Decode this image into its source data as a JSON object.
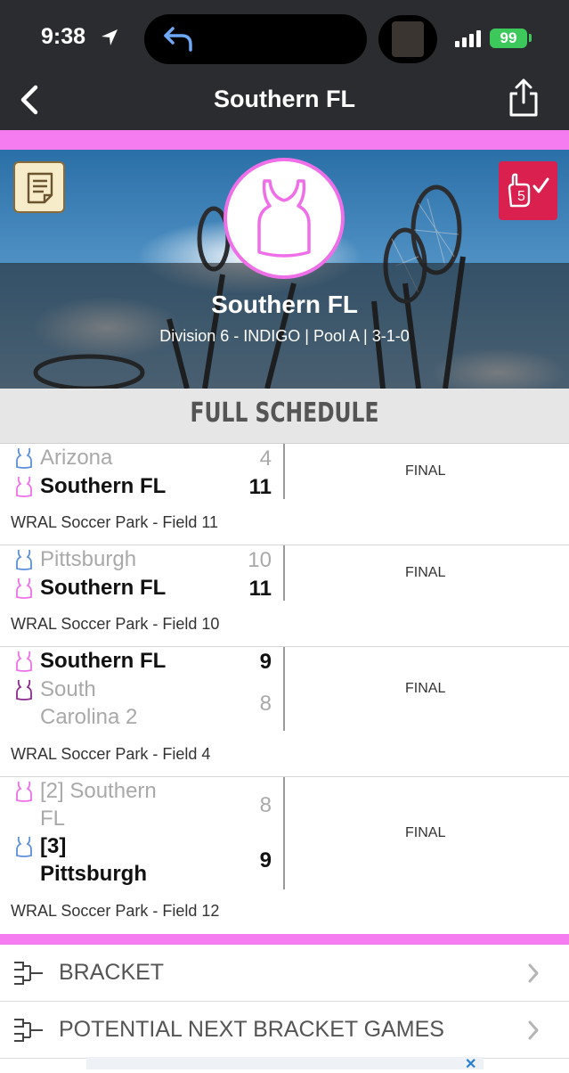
{
  "status_bar": {
    "time": "9:38",
    "battery": "99"
  },
  "nav": {
    "title": "Southern FL",
    "back_icon": "chevron-left-icon",
    "share_icon": "share-icon"
  },
  "team": {
    "name": "Southern FL",
    "subtitle": "Division 6 - INDIGO | Pool A | 3-1-0",
    "color": "#f57cf0"
  },
  "schedule": {
    "title": "FULL SCHEDULE",
    "games": [
      {
        "home": "Arizona",
        "home_score": "4",
        "home_result": "lose",
        "home_color": "#5b8fd8",
        "away": "Southern FL",
        "away_score": "11",
        "away_result": "win",
        "away_color": "#ef6fe8",
        "status": "FINAL",
        "venue": "WRAL Soccer Park - Field 11"
      },
      {
        "home": "Pittsburgh",
        "home_score": "10",
        "home_result": "lose",
        "home_color": "#5b8fd8",
        "away": "Southern FL",
        "away_score": "11",
        "away_result": "win",
        "away_color": "#ef6fe8",
        "status": "FINAL",
        "venue": "WRAL Soccer Park - Field 10"
      },
      {
        "home": "Southern FL",
        "home_score": "9",
        "home_result": "win",
        "home_color": "#ef6fe8",
        "away_line1": "South",
        "away_line2": "Carolina 2",
        "away_score": "8",
        "away_result": "lose",
        "away_color": "#8b2a8f",
        "status": "FINAL",
        "venue": "WRAL Soccer Park - Field 4"
      },
      {
        "home_line1": "[2] Southern",
        "home_line2": "FL",
        "home_score": "8",
        "home_result": "lose",
        "home_color": "#ef6fe8",
        "away_line1": "[3]",
        "away_line2": "Pittsburgh",
        "away_score": "9",
        "away_result": "win",
        "away_color": "#5b8fd8",
        "status": "FINAL",
        "venue": "WRAL Soccer Park - Field 12"
      }
    ]
  },
  "menu": [
    {
      "label": "BRACKET",
      "icon": "bracket-icon"
    },
    {
      "label": "POTENTIAL NEXT BRACKET GAMES",
      "icon": "bracket-icon"
    }
  ]
}
